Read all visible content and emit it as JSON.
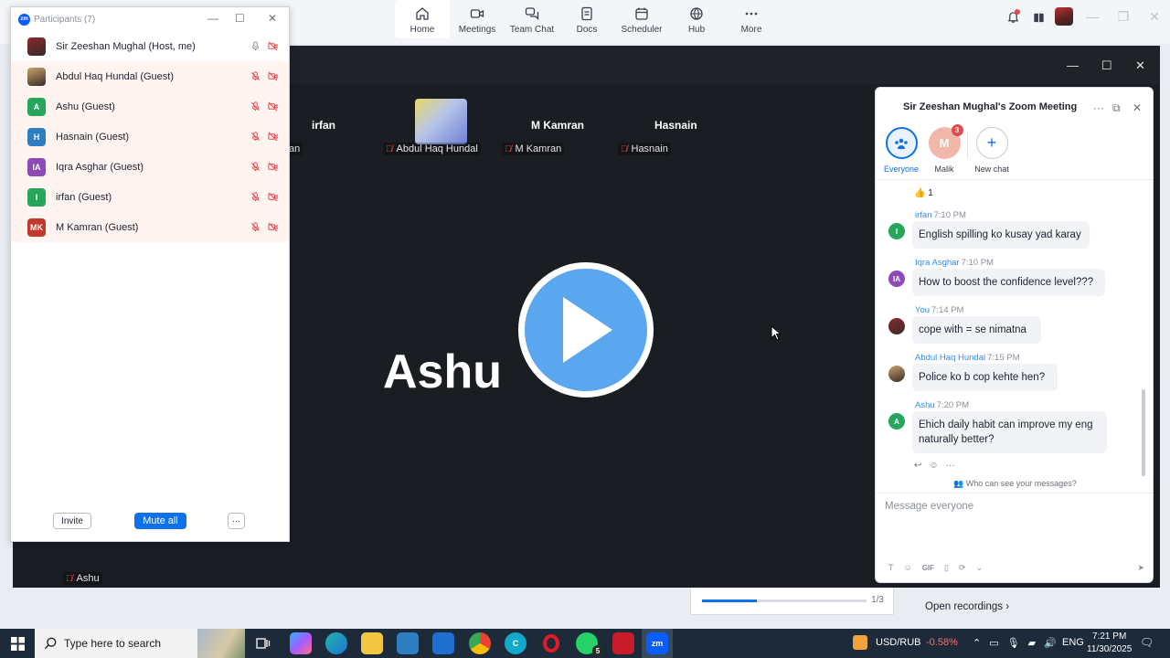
{
  "topbar": {
    "nav": [
      {
        "label": "Home",
        "icon": "home-icon",
        "active": true
      },
      {
        "label": "Meetings",
        "icon": "video-camera-icon",
        "active": false
      },
      {
        "label": "Team Chat",
        "icon": "chat-bubbles-icon",
        "active": false
      },
      {
        "label": "Docs",
        "icon": "document-icon",
        "active": false
      },
      {
        "label": "Scheduler",
        "icon": "calendar-icon",
        "active": false
      },
      {
        "label": "Hub",
        "icon": "hub-icon",
        "active": false
      },
      {
        "label": "More",
        "icon": "more-dots-icon",
        "active": false
      }
    ]
  },
  "meeting": {
    "tiles": [
      {
        "name": "irfan",
        "label": "fan"
      },
      {
        "name": "",
        "label": "Abdul Haq Hundal"
      },
      {
        "name": "M Kamran",
        "label": "M Kamran"
      },
      {
        "name": "Hasnain",
        "label": "Hasnain"
      }
    ],
    "active_speaker": "Ashu",
    "speaker_label": "Ashu"
  },
  "participants": {
    "title": "Participants (7)",
    "list": [
      {
        "name": "Sir Zeeshan Mughal (Host, me)",
        "initials": "",
        "color": "#8a2a2a",
        "photo": true,
        "mic_muted": false
      },
      {
        "name": "Abdul Haq Hundal (Guest)",
        "initials": "",
        "color": "#c9a46a",
        "photo": true,
        "mic_muted": true
      },
      {
        "name": "Ashu (Guest)",
        "initials": "A",
        "color": "#26a65b",
        "photo": false,
        "mic_muted": true
      },
      {
        "name": "Hasnain (Guest)",
        "initials": "H",
        "color": "#2d7fc1",
        "photo": false,
        "mic_muted": true
      },
      {
        "name": "Iqra Asghar (Guest)",
        "initials": "IA",
        "color": "#8e4bb8",
        "photo": false,
        "mic_muted": true
      },
      {
        "name": "irfan (Guest)",
        "initials": "I",
        "color": "#26a65b",
        "photo": false,
        "mic_muted": true
      },
      {
        "name": "M Kamran (Guest)",
        "initials": "MK",
        "color": "#c0392b",
        "photo": false,
        "mic_muted": true
      }
    ],
    "invite_label": "Invite",
    "mute_all_label": "Mute all",
    "more_label": "···"
  },
  "chat": {
    "title": "Sir Zeeshan Mughal's Zoom Meeting",
    "channels": [
      {
        "label": "Everyone",
        "kind": "everyone"
      },
      {
        "label": "Malik",
        "initial": "M",
        "badge": "3"
      },
      {
        "label": "New chat",
        "kind": "new"
      }
    ],
    "reaction": "👍 1",
    "messages": [
      {
        "sender": "irfan",
        "time": "7:10 PM",
        "text": "English spilling   ko kusay yad karay",
        "initials": "I",
        "color": "#26a65b"
      },
      {
        "sender": "Iqra Asghar",
        "time": "7:10 PM",
        "text": "How to boost the confidence level???",
        "initials": "IA",
        "color": "#8e4bb8"
      },
      {
        "sender": "You",
        "time": "7:14 PM",
        "text": "cope with = se nimatna",
        "initials": "",
        "color": "#8a2a2a"
      },
      {
        "sender": "Abdul Haq Hundal",
        "time": "7:15 PM",
        "text": "Police ko b cop kehte hen?",
        "initials": "",
        "color": "#c9a46a"
      },
      {
        "sender": "Ashu",
        "time": "7:20 PM",
        "text": "Ehich daily habit can improve my eng naturally better?",
        "initials": "A",
        "color": "#26a65b"
      }
    ],
    "who_can_see": "Who can see your messages?",
    "input_placeholder": "Message everyone"
  },
  "background": {
    "rec_page": "1/3",
    "rec_progress": 0.333,
    "open_recordings": "Open recordings"
  },
  "taskbar": {
    "search_placeholder": "Type here to search",
    "whatsapp_badge": "5",
    "currency": "USD/RUB",
    "currency_change": "-0.58%",
    "language": "ENG",
    "time": "7:21 PM",
    "date": "11/30/2025"
  }
}
